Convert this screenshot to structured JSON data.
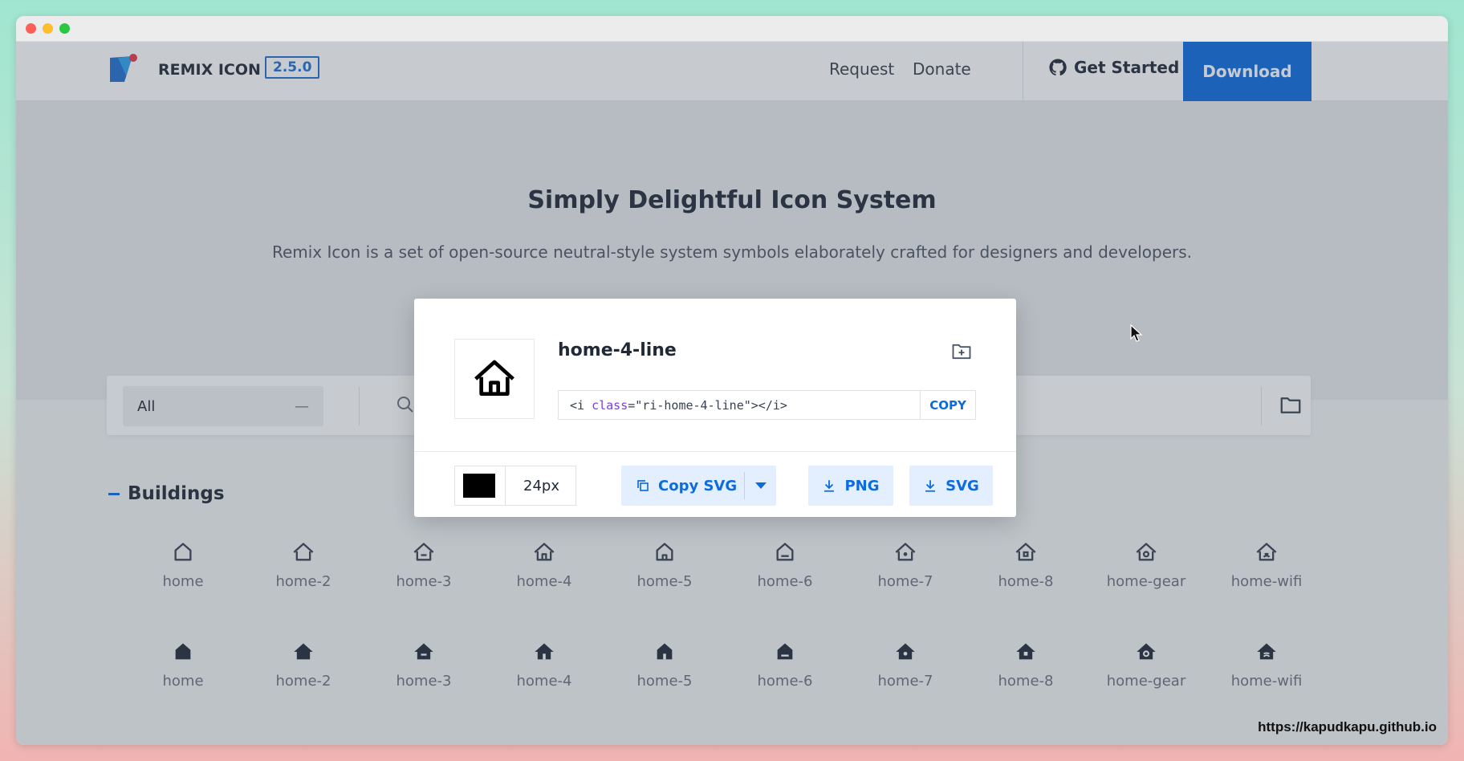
{
  "nav": {
    "brand": "REMIX ICON",
    "version": "2.5.0",
    "request": "Request",
    "donate": "Donate",
    "get_started": "Get Started",
    "download": "Download"
  },
  "hero": {
    "title": "Simply Delightful Icon System",
    "subtitle": "Remix Icon is a set of open-source neutral-style system symbols elaborately crafted for designers and developers."
  },
  "search": {
    "category": "All",
    "category_caret": "—"
  },
  "section": {
    "title": "Buildings"
  },
  "icons": {
    "row1": [
      "home",
      "home-2",
      "home-3",
      "home-4",
      "home-5",
      "home-6",
      "home-7",
      "home-8",
      "home-gear",
      "home-wifi"
    ],
    "row2": [
      "home",
      "home-2",
      "home-3",
      "home-4",
      "home-5",
      "home-6",
      "home-7",
      "home-8",
      "home-gear",
      "home-wifi"
    ]
  },
  "modal": {
    "icon_name": "home-4-line",
    "code_open": "<i ",
    "code_attr": "class",
    "code_value": "=\"ri-home-4-line\"></i>",
    "copy": "COPY",
    "size": "24px",
    "color": "#000000",
    "copy_svg": "Copy SVG",
    "png": "PNG",
    "svg": "SVG"
  },
  "watermark": "https://kapudkapu.github.io",
  "colors": {
    "accent": "#0b6be0",
    "overlay": "rgba(70,78,92,0.30)"
  }
}
